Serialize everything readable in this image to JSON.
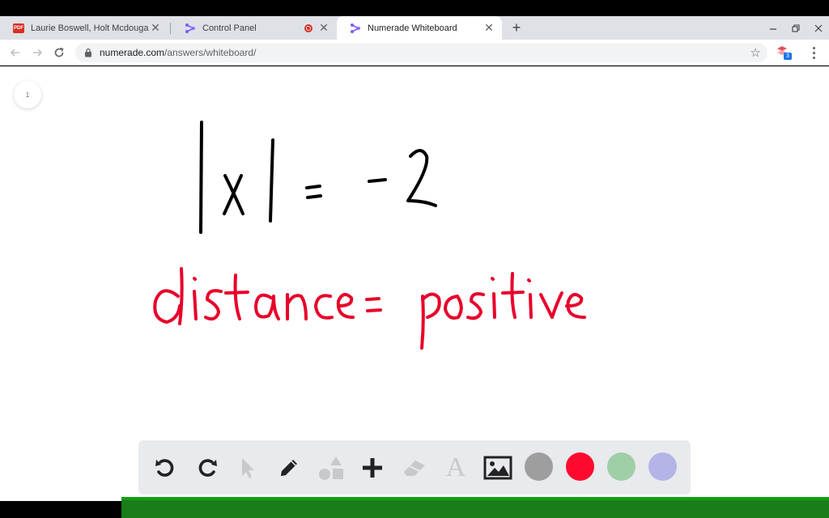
{
  "browser": {
    "tabs": [
      {
        "title": "Laurie Boswell, Holt Mcdougal - ",
        "favicon": "pdf-icon",
        "favicon_text": "PDF",
        "active": false
      },
      {
        "title": "Control Panel",
        "favicon": "numerade-icon",
        "recording": true,
        "active": false
      },
      {
        "title": "Numerade Whiteboard",
        "favicon": "numerade-icon",
        "active": true
      }
    ],
    "close_glyph": "✕",
    "new_tab_glyph": "+",
    "url_host": "numerade.com",
    "url_path": "/answers/whiteboard/",
    "extension_badge": "3"
  },
  "whiteboard": {
    "page_number": "1",
    "equation": "|x| = -2",
    "note": "distance = positive",
    "ink_colors": {
      "black": "#000000",
      "red": "#e8002a"
    }
  },
  "drawing_toolbar": {
    "tools": [
      {
        "name": "undo-icon",
        "enabled": true
      },
      {
        "name": "redo-icon",
        "enabled": true
      },
      {
        "name": "pointer-icon",
        "enabled": false
      },
      {
        "name": "pencil-icon",
        "enabled": true
      },
      {
        "name": "shapes-icon",
        "enabled": false
      },
      {
        "name": "plus-icon",
        "enabled": true
      },
      {
        "name": "eraser-icon",
        "enabled": false
      },
      {
        "name": "text-icon",
        "enabled": false
      },
      {
        "name": "image-icon",
        "enabled": true
      }
    ],
    "text_tool_glyph": "A",
    "colors": [
      "#9e9e9e",
      "#ff0a2e",
      "#9fcea7",
      "#b4b4e6"
    ]
  }
}
